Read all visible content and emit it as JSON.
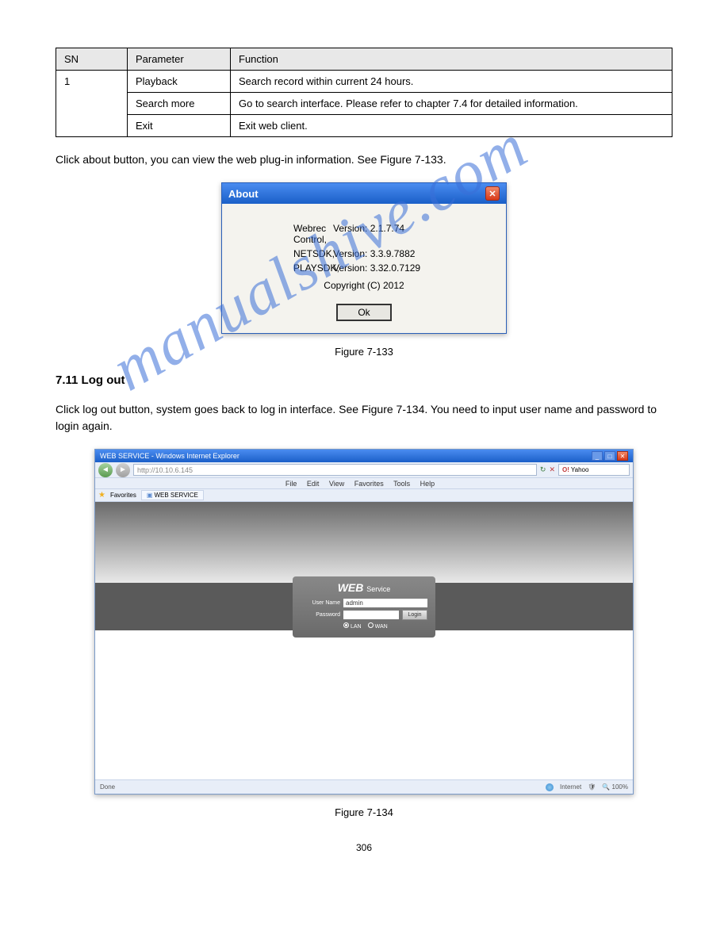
{
  "table": {
    "headers": [
      "SN",
      "Parameter",
      "Function"
    ],
    "rows": [
      {
        "sn": "1",
        "param": "Playback",
        "func": "Search record within current 24 hours."
      },
      {
        "sn": "",
        "param": "Search more",
        "func": "Go to search interface. Please refer to chapter 7.4 for detailed information."
      },
      {
        "sn": "",
        "param": "Exit",
        "func": "Exit web client."
      }
    ]
  },
  "para1": "Click about button, you can view the web plug-in information. See Figure 7-133.",
  "about": {
    "title": "About",
    "rows": [
      {
        "label": "Webrec Control,",
        "val": "Version: 2.1.7.74"
      },
      {
        "label": "NETSDK,",
        "val": "Version: 3.3.9.7882"
      },
      {
        "label": "PLAYSDK,",
        "val": "Version: 3.32.0.7129"
      }
    ],
    "copyright": "Copyright (C) 2012",
    "ok": "Ok"
  },
  "fig1": "Figure 7-133",
  "sec": "7.11 Log out",
  "para2": "Click log out button, system goes back to log in interface. See Figure 7-134. You need to input user name and password to login again.",
  "ie": {
    "title": "WEB SERVICE - Windows Internet Explorer",
    "addr": "http://10.10.6.145",
    "search_engine": "Yahoo",
    "menu": [
      "File",
      "Edit",
      "View",
      "Favorites",
      "Tools",
      "Help"
    ],
    "fav": "Favorites",
    "tab": "WEB SERVICE",
    "brand": "WEB",
    "brand_svc": "Service",
    "user_lbl": "User Name",
    "user_val": "admin",
    "pass_lbl": "Password",
    "login": "Login",
    "radio_lan": "LAN",
    "radio_wan": "WAN",
    "status_done": "Done",
    "status_zone": "Internet",
    "status_zoom": "100%"
  },
  "fig2": "Figure 7-134",
  "pagenum": "306",
  "watermark": "manualshive.com"
}
